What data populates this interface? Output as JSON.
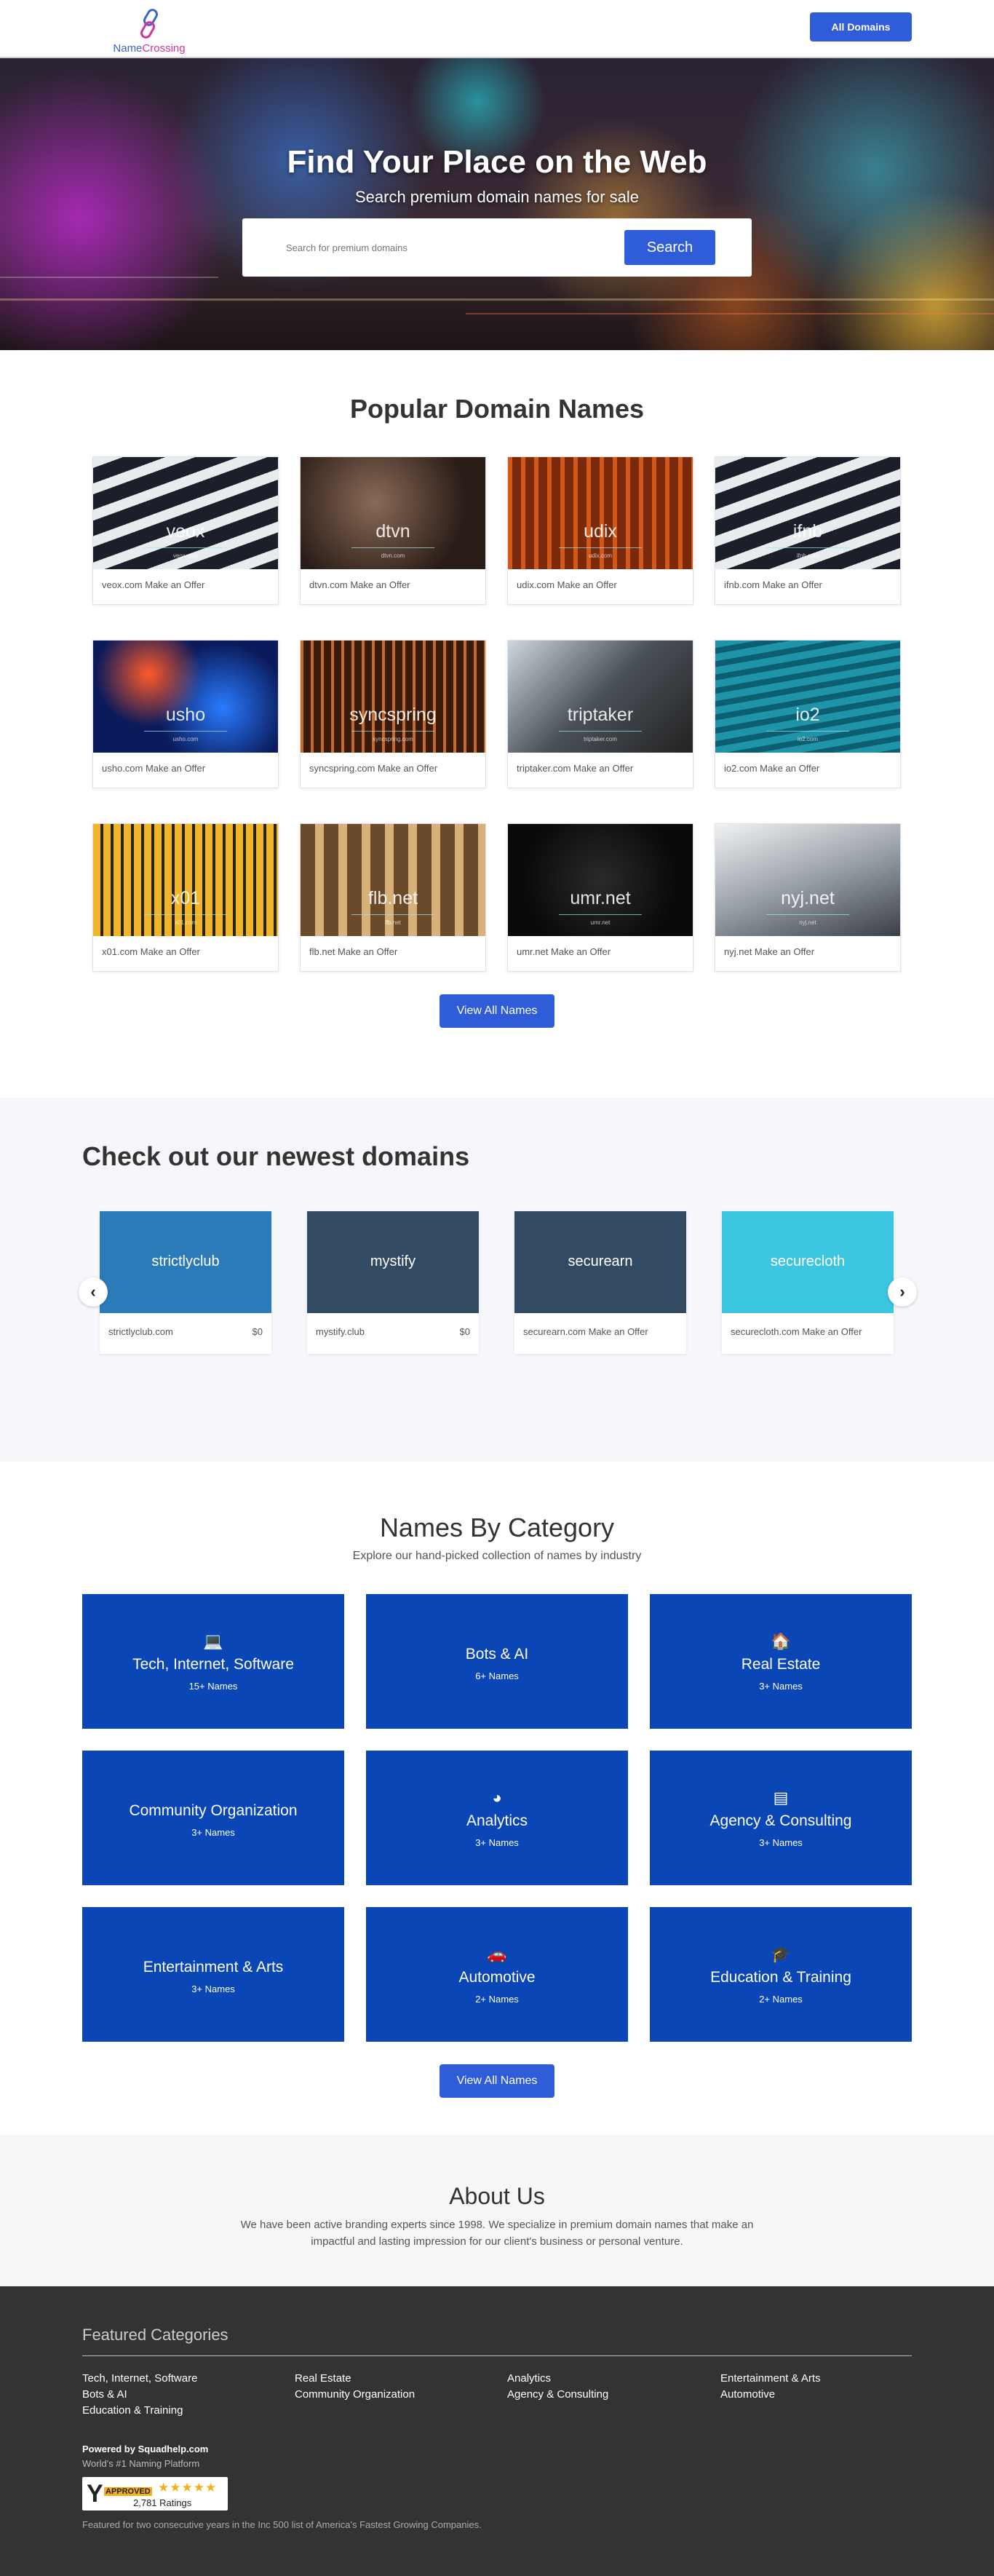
{
  "header": {
    "logo_text_a": "Name",
    "logo_text_b": "Crossing",
    "all_domains_label": "All Domains"
  },
  "hero": {
    "title": "Find Your Place on the Web",
    "subtitle": "Search premium domain names for sale",
    "search_placeholder": "Search for premium domains",
    "search_label": "Search"
  },
  "popular": {
    "title": "Popular Domain Names",
    "cards": [
      {
        "name": "veox",
        "small": "veox.com",
        "caption": "veox.com Make an Offer",
        "theme": "arch"
      },
      {
        "name": "dtvn",
        "small": "dtvn.com",
        "caption": "dtvn.com Make an Offer",
        "theme": "brown"
      },
      {
        "name": "udix",
        "small": "udix.com",
        "caption": "udix.com Make an Offer",
        "theme": "orange"
      },
      {
        "name": "ifnb",
        "small": "ifnb.com",
        "caption": "ifnb.com Make an Offer",
        "theme": "arch"
      },
      {
        "name": "usho",
        "small": "usho.com",
        "caption": "usho.com Make an Offer",
        "theme": "colorful"
      },
      {
        "name": "syncspring",
        "small": "syncspring.com",
        "caption": "syncspring.com Make an Offer",
        "theme": "copper"
      },
      {
        "name": "triptaker",
        "small": "triptaker.com",
        "caption": "triptaker.com Make an Offer",
        "theme": "glass"
      },
      {
        "name": "io2",
        "small": "io2.com",
        "caption": "io2.com Make an Offer",
        "theme": "teal"
      },
      {
        "name": "x01",
        "small": "x01.com",
        "caption": "x01.com Make an Offer",
        "theme": "yellow"
      },
      {
        "name": "flb.net",
        "small": "flb.net",
        "caption": "flb.net Make an Offer",
        "theme": "windows"
      },
      {
        "name": "umr.net",
        "small": "umr.net",
        "caption": "umr.net Make an Offer",
        "theme": "night"
      },
      {
        "name": "nyj.net",
        "small": "nyj.net",
        "caption": "nyj.net Make an Offer",
        "theme": "sky"
      }
    ],
    "view_all_label": "View All Names"
  },
  "newest": {
    "title": "Check out our newest domains",
    "cards": [
      {
        "name": "strictlyclub",
        "domain": "strictlyclub.com",
        "price": "$0",
        "color": "#2b7bb9"
      },
      {
        "name": "mystify",
        "domain": "mystify.club",
        "price": "$0",
        "color": "#334a63"
      },
      {
        "name": "securearn",
        "domain": "securearn.com Make an Offer",
        "price": "",
        "color": "#334a63"
      },
      {
        "name": "securecloth",
        "domain": "securecloth.com Make an Offer",
        "price": "",
        "color": "#3cc5e0"
      }
    ],
    "prev_icon": "‹",
    "next_icon": "›"
  },
  "categories": {
    "title": "Names By Category",
    "subtitle": "Explore our hand-picked collection of names by industry",
    "items": [
      {
        "name": "Tech, Internet, Software",
        "count": "15+ Names",
        "icon": "laptop-icon",
        "glyph": "💻"
      },
      {
        "name": "Bots & AI",
        "count": "6+ Names",
        "icon": "",
        "glyph": ""
      },
      {
        "name": "Real Estate",
        "count": "3+ Names",
        "icon": "home-icon",
        "glyph": "🏠"
      },
      {
        "name": "Community Organization",
        "count": "3+ Names",
        "icon": "",
        "glyph": ""
      },
      {
        "name": "Analytics",
        "count": "3+ Names",
        "icon": "pie-chart-icon",
        "glyph": "◕"
      },
      {
        "name": "Agency & Consulting",
        "count": "3+ Names",
        "icon": "document-icon",
        "glyph": "▤"
      },
      {
        "name": "Entertainment & Arts",
        "count": "3+ Names",
        "icon": "",
        "glyph": ""
      },
      {
        "name": "Automotive",
        "count": "2+ Names",
        "icon": "car-icon",
        "glyph": "🚗"
      },
      {
        "name": "Education & Training",
        "count": "2+ Names",
        "icon": "graduation-cap-icon",
        "glyph": "🎓"
      }
    ],
    "view_all_label": "View All Names"
  },
  "about": {
    "title": "About Us",
    "text": "We have been active branding experts since 1998.  We specialize in premium domain names that make an impactful and lasting impression for our client's business or personal venture."
  },
  "footer": {
    "title": "Featured Categories",
    "columns": [
      [
        "Tech, Internet, Software",
        "Bots & AI",
        "Education & Training"
      ],
      [
        "Real Estate",
        "Community Organization"
      ],
      [
        "Analytics",
        "Agency & Consulting"
      ],
      [
        "Entertainment & Arts",
        "Automotive"
      ]
    ],
    "powered": "Powered by Squadhelp.com",
    "powered_sub": "World's #1 Naming Platform",
    "badge_approved": "APPROVED",
    "badge_ratings": "2,781 Ratings",
    "inc_text": "Featured for two consecutive years in the Inc 500 list of America's Fastest Growing Companies."
  }
}
